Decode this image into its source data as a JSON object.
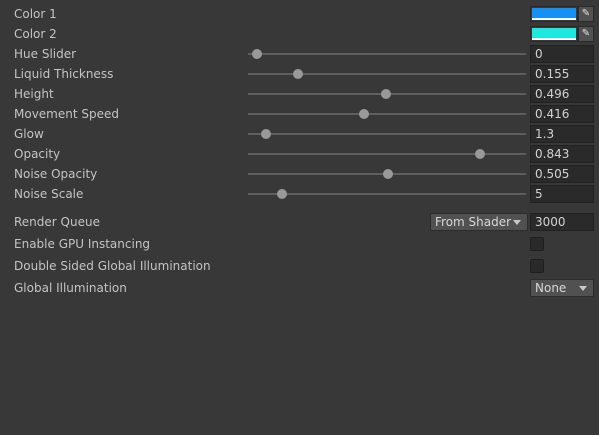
{
  "colors": [
    {
      "label": "Color 1",
      "swatch": "#1591f5",
      "picker_icon": "eyedropper-icon"
    },
    {
      "label": "Color 2",
      "swatch": "#1de9e0",
      "picker_icon": "eyedropper-icon"
    }
  ],
  "sliders": [
    {
      "label": "Hue Slider",
      "value": "0",
      "fraction": 0.02
    },
    {
      "label": "Liquid Thickness",
      "value": "0.155",
      "fraction": 0.17
    },
    {
      "label": "Height",
      "value": "0.496",
      "fraction": 0.496
    },
    {
      "label": "Movement Speed",
      "value": "0.416",
      "fraction": 0.416
    },
    {
      "label": "Glow",
      "value": "1.3",
      "fraction": 0.05
    },
    {
      "label": "Opacity",
      "value": "0.843",
      "fraction": 0.843
    },
    {
      "label": "Noise Opacity",
      "value": "0.505",
      "fraction": 0.505
    },
    {
      "label": "Noise Scale",
      "value": "5",
      "fraction": 0.11
    }
  ],
  "render_queue": {
    "label": "Render Queue",
    "dropdown": "From Shader",
    "value": "3000"
  },
  "gpu_instancing": {
    "label": "Enable GPU Instancing",
    "checked": false
  },
  "double_sided_gi": {
    "label": "Double Sided Global Illumination",
    "checked": false
  },
  "global_illumination": {
    "label": "Global Illumination",
    "dropdown": "None"
  }
}
